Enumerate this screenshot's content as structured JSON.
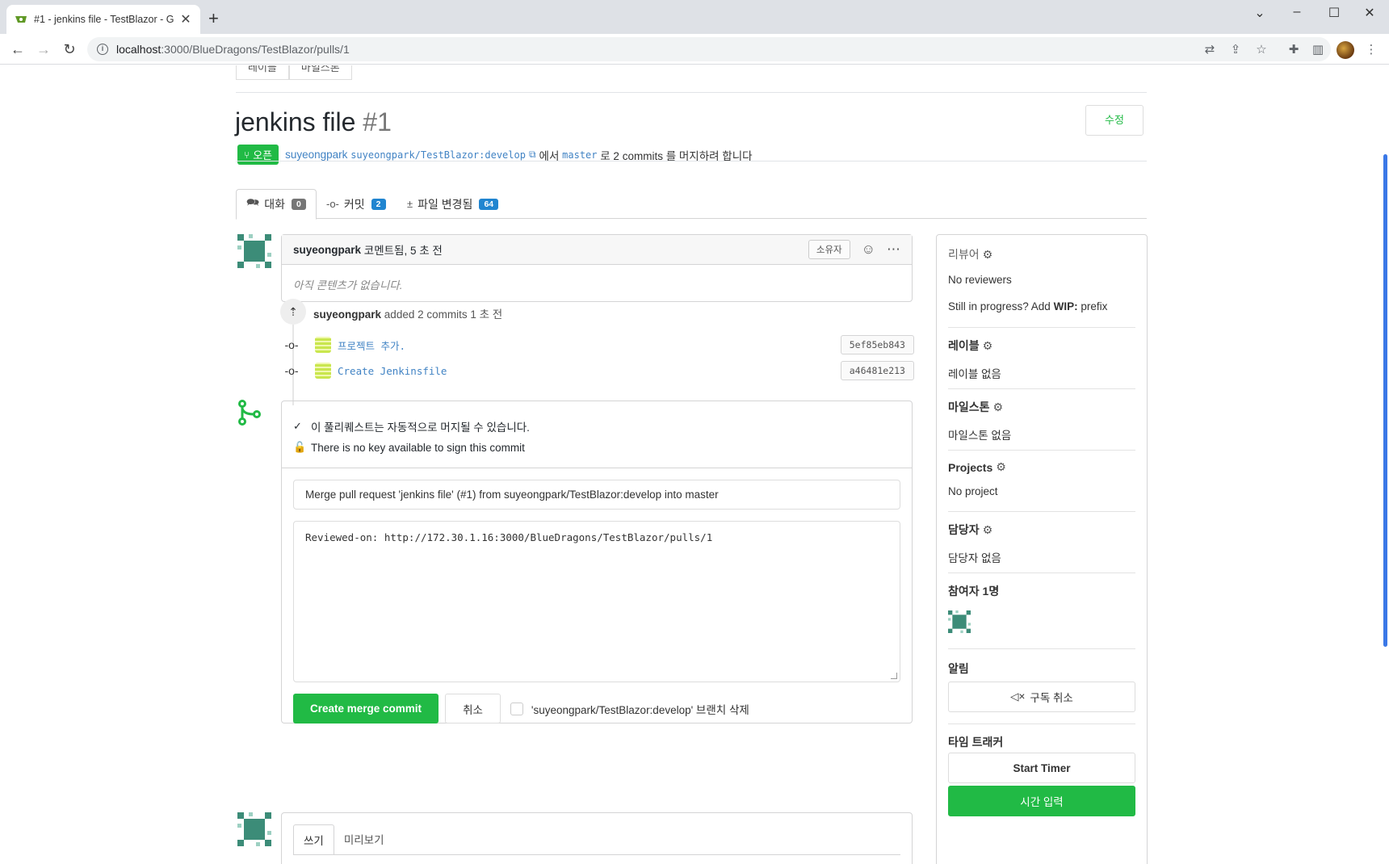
{
  "browser": {
    "tab_title": "#1 - jenkins file - TestBlazor - G",
    "url_host": "localhost",
    "url_path": ":3000/BlueDragons/TestBlazor/pulls/1"
  },
  "top_tabs": [
    "레이블",
    "마일스톤"
  ],
  "pr": {
    "title": "jenkins file",
    "number": "#1",
    "edit_label": "수정",
    "status": "오픈",
    "author": "suyeongpark",
    "head_branch": "suyeongpark/TestBlazor:develop",
    "from_text": "에서",
    "base_branch": "master",
    "summary_text": "로 2 commits 를 머지하려 합니다"
  },
  "pr_tabs": [
    {
      "label": "대화",
      "count": "0",
      "icon": "comments-icon"
    },
    {
      "label": "커밋",
      "count": "2",
      "icon": "commit-icon"
    },
    {
      "label": "파일 변경됨",
      "count": "64",
      "icon": "diff-icon"
    }
  ],
  "comment": {
    "author": "suyeongpark",
    "action": "코멘트됨, 5 초 전",
    "role": "소유자",
    "body": "아직 콘텐츠가 없습니다."
  },
  "push_event": {
    "author": "suyeongpark",
    "text": "added 2 commits 1 초 전"
  },
  "commits": [
    {
      "message": "프로젝트 추가.",
      "sha": "5ef85eb843"
    },
    {
      "message": "Create Jenkinsfile",
      "sha": "a46481e213"
    }
  ],
  "merge": {
    "status_ok": "이 풀리퀘스트는 자동적으로 머지될 수 있습니다.",
    "sign_note": "There is no key available to sign this commit",
    "title_value": "Merge pull request 'jenkins file' (#1) from suyeongpark/TestBlazor:develop into master",
    "description_value": "Reviewed-on: http://172.30.1.16:3000/BlueDragons/TestBlazor/pulls/1",
    "merge_button": "Create merge commit",
    "cancel_button": "취소",
    "delete_branch_label": "'suyeongpark/TestBlazor:develop' 브랜치 삭제"
  },
  "editor_tabs": [
    "쓰기",
    "미리보기"
  ],
  "sidebar": {
    "reviewers_head": "리뷰어",
    "reviewers_value": "No reviewers",
    "wip_prefix_text": "Still in progress? Add",
    "wip_bold": "WIP:",
    "wip_suffix": "prefix",
    "labels_head": "레이블",
    "labels_value": "레이블 없음",
    "milestone_head": "마일스톤",
    "milestone_value": "마일스톤 없음",
    "projects_head": "Projects",
    "projects_value": "No project",
    "assignees_head": "담당자",
    "assignees_value": "담당자 없음",
    "participants_head": "참여자 1명",
    "notify_head": "알림",
    "unsubscribe_button": "구독 취소",
    "tracker_head": "타임 트래커",
    "start_timer_button": "Start Timer",
    "add_time_button": "시간 입력"
  },
  "colors": {
    "accent_green": "#21ba45",
    "link_blue": "#4183c4",
    "count_blue": "#2185d0"
  }
}
